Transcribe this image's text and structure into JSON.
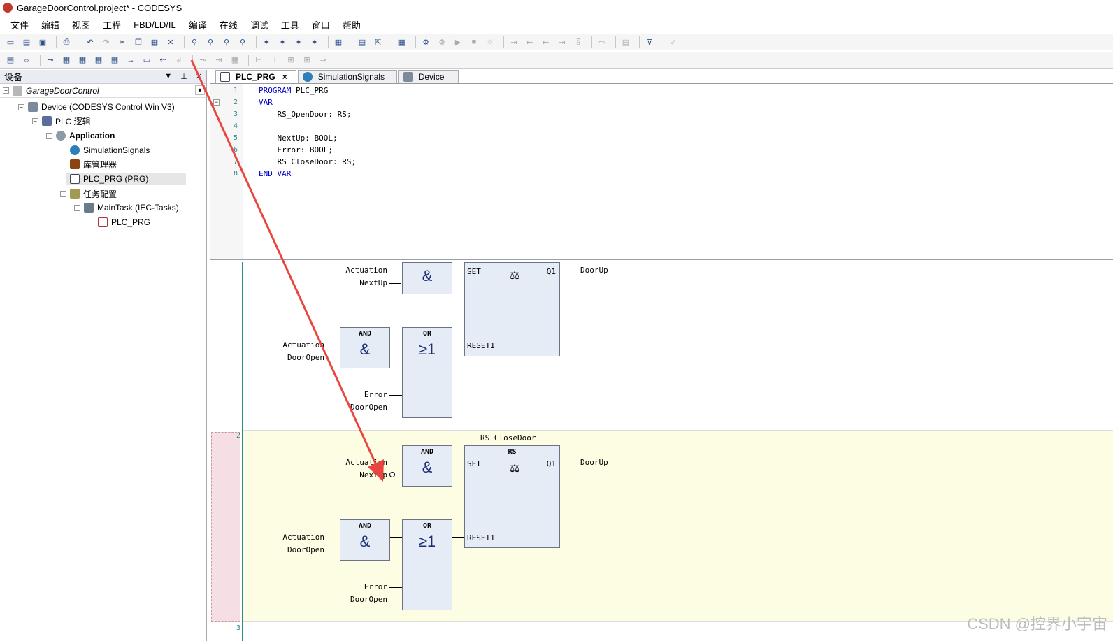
{
  "window": {
    "title": "GarageDoorControl.project* - CODESYS"
  },
  "menu": [
    "文件",
    "编辑",
    "视图",
    "工程",
    "FBD/LD/IL",
    "编译",
    "在线",
    "调试",
    "工具",
    "窗口",
    "帮助"
  ],
  "left_pane": {
    "title": "设备",
    "tree": [
      {
        "label": "GarageDoorControl"
      },
      {
        "label": "Device (CODESYS Control Win V3)"
      },
      {
        "label": "PLC 逻辑"
      },
      {
        "label": "Application"
      },
      {
        "label": "SimulationSignals"
      },
      {
        "label": "库管理器"
      },
      {
        "label": "PLC_PRG (PRG)"
      },
      {
        "label": "任务配置"
      },
      {
        "label": "MainTask (IEC-Tasks)"
      },
      {
        "label": "PLC_PRG"
      }
    ]
  },
  "tabs": [
    {
      "label": "PLC_PRG",
      "close": "×"
    },
    {
      "label": "SimulationSignals"
    },
    {
      "label": "Device"
    }
  ],
  "declaration": {
    "lines": [
      {
        "n": "1",
        "kw": "PROGRAM",
        "rest": " PLC_PRG"
      },
      {
        "n": "2",
        "kw": "VAR",
        "rest": ""
      },
      {
        "n": "3",
        "kw": "",
        "rest": "    RS_OpenDoor: RS;"
      },
      {
        "n": "4",
        "kw": "",
        "rest": ""
      },
      {
        "n": "5",
        "kw": "",
        "rest": "    NextUp: BOOL;"
      },
      {
        "n": "6",
        "kw": "",
        "rest": "    Error: BOOL;"
      },
      {
        "n": "7",
        "kw": "",
        "rest": "    RS_CloseDoor: RS;"
      },
      {
        "n": "8",
        "kw": "END_VAR",
        "rest": ""
      }
    ]
  },
  "fbd": {
    "net2_label": "2",
    "net3_label": "3",
    "net1": {
      "in1": "Actuation",
      "in2": "NextUp",
      "and_sym": "&",
      "set": "SET",
      "q1": "Q1",
      "out": "DoorUp",
      "and2_title": "AND",
      "and2_sym": "&",
      "in3": "Actuation",
      "in4": "DoorOpen",
      "or_title": "OR",
      "or_sym": "≥1",
      "in5": "Error",
      "in6": "DoorOpen",
      "reset": "RESET1"
    },
    "net2": {
      "instance": "RS_CloseDoor",
      "rs_title": "RS",
      "and1_title": "AND",
      "and1_sym": "&",
      "in1": "Actuation",
      "in2": "NextUp",
      "set": "SET",
      "q1": "Q1",
      "out": "DoorUp",
      "and2_title": "AND",
      "and2_sym": "&",
      "in3": "Actuation",
      "in4": "DoorOpen",
      "or_title": "OR",
      "or_sym": "≥1",
      "in5": "Error",
      "in6": "DoorOpen",
      "reset": "RESET1"
    }
  },
  "watermark": "CSDN @控界小宇宙",
  "colors": {
    "accent_arrow": "#e8463f",
    "block_fill": "#e6ecf5",
    "net_highlight": "#fdfde3"
  }
}
